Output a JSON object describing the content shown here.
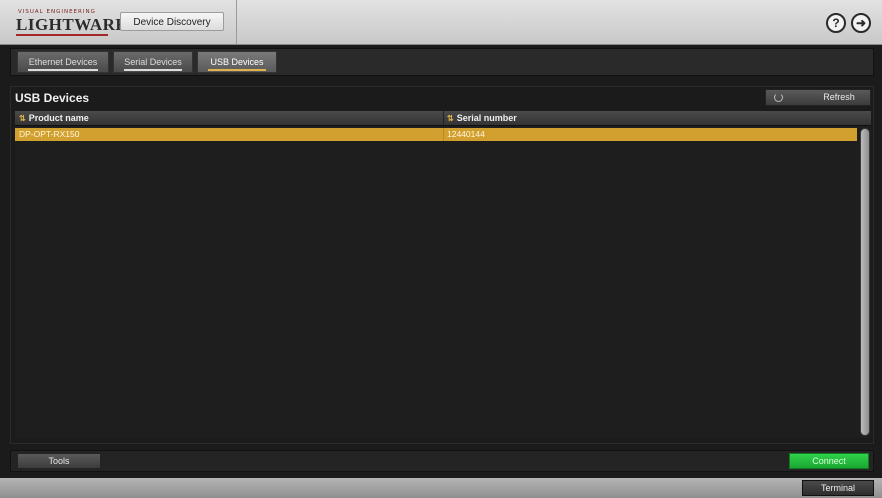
{
  "header": {
    "logo_tagline": "VISUAL ENGINEERING",
    "logo_text": "LIGHTWARE",
    "view_button": "Device Discovery",
    "help_icon": "question-circle-icon",
    "exit_icon": "exit-arrow-icon",
    "help_glyph": "?",
    "exit_glyph": "➜"
  },
  "tabs": [
    {
      "label": "Ethernet Devices",
      "active": false
    },
    {
      "label": "Serial Devices",
      "active": false
    },
    {
      "label": "USB Devices",
      "active": true
    }
  ],
  "panel": {
    "title": "USB Devices",
    "refresh_label": "Refresh",
    "columns": [
      "Product name",
      "Serial number"
    ],
    "rows": [
      {
        "product": "DP-OPT-RX150",
        "serial": "12440144",
        "selected": true
      }
    ]
  },
  "bottom": {
    "tools_label": "Tools",
    "connect_label": "Connect"
  },
  "footer": {
    "terminal_label": "Terminal"
  },
  "colors": {
    "accent": "#d2a02f",
    "connect": "#22c13e"
  }
}
